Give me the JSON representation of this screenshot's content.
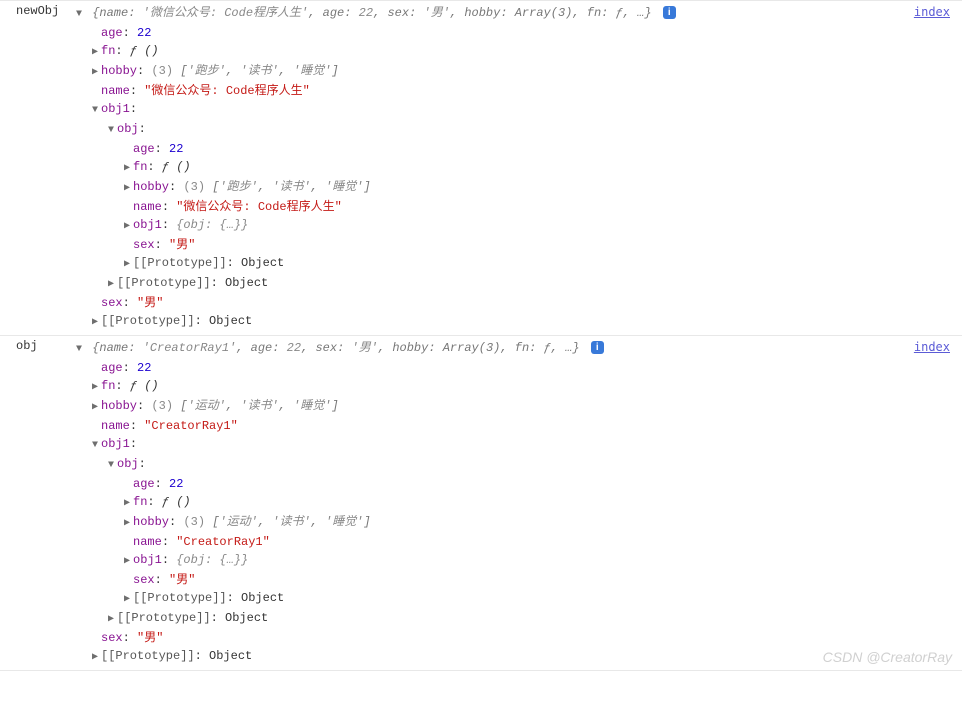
{
  "entries": [
    {
      "label": "newObj",
      "source": "index",
      "preview": "{name: '微信公众号: Code程序人生', age: 22, sex: '男', hobby: Array(3), fn: ƒ, …}",
      "p_name": "'微信公众号: Code程序人生'",
      "p_age": "22",
      "p_sex": "'男'",
      "p_hobby": "Array(3)",
      "p_fn": "ƒ",
      "age": "22",
      "fn": "ƒ ()",
      "hobby_len": "(3)",
      "hobby_items": "['跑步', '读书', '睡觉']",
      "hobby_i0": "'跑步'",
      "hobby_i1": "'读书'",
      "hobby_i2": "'睡觉'",
      "name": "\"微信公众号: Code程序人生\"",
      "obj1_label": "obj1",
      "obj_label": "obj",
      "inner": {
        "age": "22",
        "fn": "ƒ ()",
        "hobby_len": "(3)",
        "hobby_items": "['跑步', '读书', '睡觉']",
        "hobby_i0": "'跑步'",
        "hobby_i1": "'读书'",
        "hobby_i2": "'睡觉'",
        "name": "\"微信公众号: Code程序人生\"",
        "obj1_preview": "{obj: {…}}",
        "sex": "\"男\"",
        "proto": "Object"
      },
      "proto3": "Object",
      "sex": "\"男\"",
      "proto": "Object"
    },
    {
      "label": "obj",
      "source": "index",
      "preview": "{name: 'CreatorRay1', age: 22, sex: '男', hobby: Array(3), fn: ƒ, …}",
      "p_name": "'CreatorRay1'",
      "p_age": "22",
      "p_sex": "'男'",
      "p_hobby": "Array(3)",
      "p_fn": "ƒ",
      "age": "22",
      "fn": "ƒ ()",
      "hobby_len": "(3)",
      "hobby_items": "['运动', '读书', '睡觉']",
      "hobby_i0": "'运动'",
      "hobby_i1": "'读书'",
      "hobby_i2": "'睡觉'",
      "name": "\"CreatorRay1\"",
      "obj1_label": "obj1",
      "obj_label": "obj",
      "inner": {
        "age": "22",
        "fn": "ƒ ()",
        "hobby_len": "(3)",
        "hobby_items": "['运动', '读书', '睡觉']",
        "hobby_i0": "'运动'",
        "hobby_i1": "'读书'",
        "hobby_i2": "'睡觉'",
        "name": "\"CreatorRay1\"",
        "obj1_preview": "{obj: {…}}",
        "sex": "\"男\"",
        "proto": "Object"
      },
      "proto3": "Object",
      "sex": "\"男\"",
      "proto": "Object"
    }
  ],
  "k": {
    "age": "age",
    "fn": "fn",
    "hobby": "hobby",
    "name": "name",
    "obj1": "obj1",
    "obj": "obj",
    "sex": "sex",
    "proto": "[[Prototype]]"
  },
  "icons": {
    "down": "▼",
    "right": "▶",
    "info": "i"
  },
  "watermark": "CSDN @CreatorRay"
}
